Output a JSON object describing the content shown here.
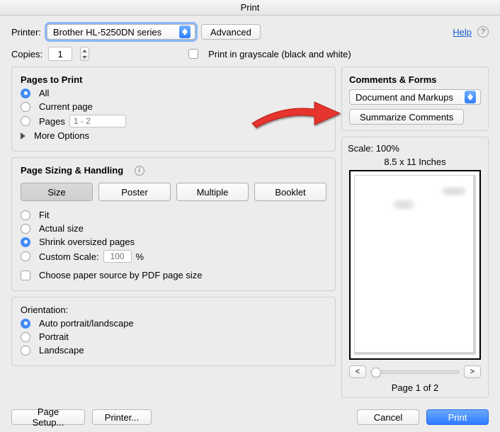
{
  "title": "Print",
  "help_label": "Help",
  "printer": {
    "label": "Printer:",
    "value": "Brother HL-5250DN series",
    "advanced": "Advanced"
  },
  "copies": {
    "label": "Copies:",
    "value": "1",
    "grayscale": "Print in grayscale (black and white)"
  },
  "pages_to_print": {
    "title": "Pages to Print",
    "all": "All",
    "current": "Current page",
    "pages": "Pages",
    "pages_placeholder": "1 - 2",
    "more": "More Options"
  },
  "sizing": {
    "title": "Page Sizing & Handling",
    "tabs": {
      "size": "Size",
      "poster": "Poster",
      "multiple": "Multiple",
      "booklet": "Booklet"
    },
    "fit": "Fit",
    "actual": "Actual size",
    "shrink": "Shrink oversized pages",
    "custom": "Custom Scale:",
    "custom_value": "100",
    "pct": "%",
    "choose_source": "Choose paper source by PDF page size"
  },
  "orientation": {
    "title": "Orientation:",
    "auto": "Auto portrait/landscape",
    "portrait": "Portrait",
    "landscape": "Landscape"
  },
  "comments": {
    "title": "Comments & Forms",
    "value": "Document and Markups",
    "summarize": "Summarize Comments"
  },
  "preview": {
    "scale": "Scale: 100%",
    "dims": "8.5 x 11 Inches",
    "page": "Page 1 of 2",
    "prev": "<",
    "next": ">"
  },
  "footer": {
    "page_setup": "Page Setup...",
    "printer": "Printer...",
    "cancel": "Cancel",
    "print": "Print"
  }
}
